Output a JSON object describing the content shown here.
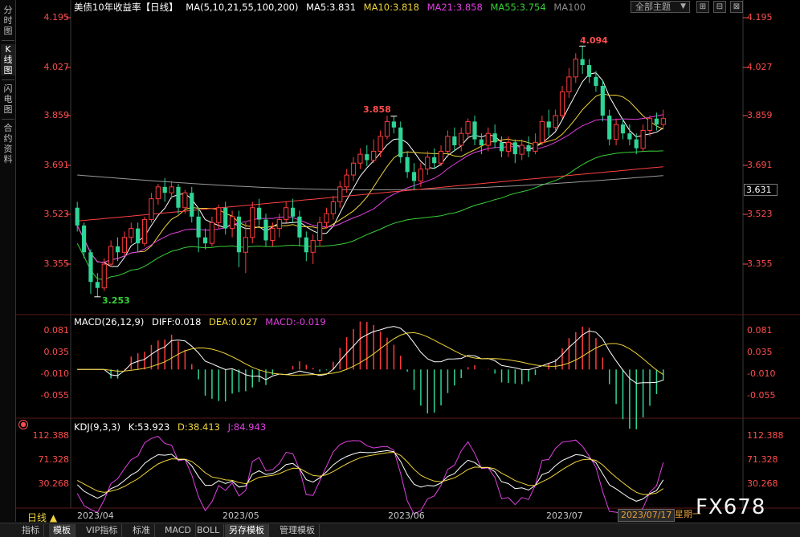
{
  "left_toolbar": {
    "items": [
      {
        "label": "分\n时\n图"
      },
      {
        "label": "K\n线\n图"
      },
      {
        "label": "闪\n电\n图"
      },
      {
        "label": "合\n约\n资\n料"
      }
    ]
  },
  "header": {
    "title": "美债10年收益率",
    "period_tag": "【日线】",
    "ma_params": "MA(5,10,21,55,100,200)",
    "ma5": "MA5:3.831",
    "ma10": "MA10:3.818",
    "ma21": "MA21:3.858",
    "ma55": "MA55:3.754",
    "ma100": "MA100",
    "theme_label": "全部主题",
    "window_buttons": [
      "⊞",
      "⊟",
      "⊠"
    ]
  },
  "main_axis": {
    "left_ticks": [
      "4.195",
      "4.027",
      "3.859",
      "3.691",
      "3.523",
      "3.355"
    ],
    "right_ticks": [
      "4.195",
      "4.027",
      "3.859",
      "3.691",
      "3.523",
      "3.355"
    ],
    "last_price": "3.631",
    "high_label": "4.094",
    "mid_high_label": "3.858",
    "low_label": "3.253"
  },
  "macd": {
    "title": "MACD(26,12,9)",
    "diff": "DIFF:0.018",
    "dea": "DEA:0.027",
    "macd": "MACD:-0.019",
    "ticks": [
      "0.081",
      "0.035",
      "-0.010",
      "-0.055"
    ]
  },
  "kdj": {
    "title": "KDJ(9,3,3)",
    "k": "K:53.923",
    "d": "D:38.413",
    "j": "J:84.943",
    "ticks": [
      "112.388",
      "71.328",
      "30.268"
    ]
  },
  "date_axis": {
    "period": "日线 ▲",
    "labels": [
      "2023/04",
      "2023/05",
      "2023/06",
      "2023/07"
    ],
    "cursor_date": "2023/07/17",
    "cursor_week": "星期一"
  },
  "watermark": "FX678",
  "bottom_tabs": [
    "指标",
    "模板",
    "VIP指标",
    "标准",
    "MACD",
    "BOLL",
    "另存模板",
    "管理模板"
  ],
  "colors": {
    "up": "#ff3b3b",
    "down": "#2fd596",
    "ma5": "#ffffff",
    "ma10": "#f0d43a",
    "ma21": "#e040e0",
    "ma55": "#38d038",
    "ma100": "#9a9a9a",
    "ma200": "#ff4040"
  },
  "chart_data": {
    "type": "candlestick",
    "series_open_close_high_low": [
      [
        3.55,
        3.49,
        3.57,
        3.47
      ],
      [
        3.49,
        3.4,
        3.5,
        3.38
      ],
      [
        3.4,
        3.3,
        3.41,
        3.26
      ],
      [
        3.3,
        3.28,
        3.33,
        3.25
      ],
      [
        3.28,
        3.36,
        3.38,
        3.27
      ],
      [
        3.36,
        3.42,
        3.44,
        3.35
      ],
      [
        3.42,
        3.4,
        3.45,
        3.37
      ],
      [
        3.4,
        3.45,
        3.47,
        3.39
      ],
      [
        3.45,
        3.48,
        3.5,
        3.43
      ],
      [
        3.48,
        3.43,
        3.5,
        3.4
      ],
      [
        3.43,
        3.51,
        3.52,
        3.42
      ],
      [
        3.51,
        3.58,
        3.6,
        3.5
      ],
      [
        3.58,
        3.62,
        3.63,
        3.56
      ],
      [
        3.62,
        3.6,
        3.65,
        3.57
      ],
      [
        3.6,
        3.62,
        3.64,
        3.58
      ],
      [
        3.62,
        3.55,
        3.63,
        3.53
      ],
      [
        3.55,
        3.6,
        3.61,
        3.53
      ],
      [
        3.6,
        3.52,
        3.62,
        3.5
      ],
      [
        3.52,
        3.45,
        3.55,
        3.4
      ],
      [
        3.45,
        3.43,
        3.48,
        3.41
      ],
      [
        3.43,
        3.5,
        3.52,
        3.42
      ],
      [
        3.5,
        3.55,
        3.56,
        3.48
      ],
      [
        3.55,
        3.48,
        3.57,
        3.46
      ],
      [
        3.48,
        3.52,
        3.54,
        3.45
      ],
      [
        3.52,
        3.4,
        3.54,
        3.35
      ],
      [
        3.4,
        3.45,
        3.5,
        3.33
      ],
      [
        3.45,
        3.55,
        3.57,
        3.43
      ],
      [
        3.55,
        3.51,
        3.58,
        3.49
      ],
      [
        3.51,
        3.44,
        3.53,
        3.42
      ],
      [
        3.44,
        3.48,
        3.5,
        3.42
      ],
      [
        3.48,
        3.51,
        3.53,
        3.45
      ],
      [
        3.51,
        3.55,
        3.57,
        3.5
      ],
      [
        3.55,
        3.52,
        3.58,
        3.5
      ],
      [
        3.52,
        3.45,
        3.54,
        3.42
      ],
      [
        3.45,
        3.4,
        3.47,
        3.37
      ],
      [
        3.4,
        3.44,
        3.46,
        3.36
      ],
      [
        3.44,
        3.5,
        3.52,
        3.42
      ],
      [
        3.5,
        3.53,
        3.55,
        3.48
      ],
      [
        3.53,
        3.57,
        3.59,
        3.51
      ],
      [
        3.57,
        3.62,
        3.64,
        3.55
      ],
      [
        3.62,
        3.66,
        3.68,
        3.6
      ],
      [
        3.66,
        3.7,
        3.72,
        3.64
      ],
      [
        3.7,
        3.73,
        3.75,
        3.68
      ],
      [
        3.73,
        3.71,
        3.76,
        3.69
      ],
      [
        3.71,
        3.74,
        3.78,
        3.7
      ],
      [
        3.74,
        3.79,
        3.81,
        3.72
      ],
      [
        3.79,
        3.84,
        3.86,
        3.78
      ],
      [
        3.84,
        3.82,
        3.858,
        3.8
      ],
      [
        3.82,
        3.72,
        3.84,
        3.7
      ],
      [
        3.72,
        3.67,
        3.74,
        3.65
      ],
      [
        3.67,
        3.64,
        3.7,
        3.61
      ],
      [
        3.64,
        3.68,
        3.7,
        3.62
      ],
      [
        3.68,
        3.72,
        3.74,
        3.66
      ],
      [
        3.72,
        3.7,
        3.75,
        3.68
      ],
      [
        3.7,
        3.74,
        3.76,
        3.69
      ],
      [
        3.74,
        3.79,
        3.81,
        3.72
      ],
      [
        3.79,
        3.76,
        3.82,
        3.74
      ],
      [
        3.76,
        3.8,
        3.82,
        3.74
      ],
      [
        3.8,
        3.84,
        3.85,
        3.78
      ],
      [
        3.84,
        3.78,
        3.86,
        3.76
      ],
      [
        3.78,
        3.76,
        3.8,
        3.73
      ],
      [
        3.76,
        3.8,
        3.82,
        3.74
      ],
      [
        3.8,
        3.77,
        3.83,
        3.75
      ],
      [
        3.77,
        3.74,
        3.79,
        3.72
      ],
      [
        3.74,
        3.77,
        3.79,
        3.72
      ],
      [
        3.77,
        3.73,
        3.78,
        3.7
      ],
      [
        3.73,
        3.76,
        3.78,
        3.71
      ],
      [
        3.76,
        3.74,
        3.79,
        3.72
      ],
      [
        3.74,
        3.77,
        3.8,
        3.73
      ],
      [
        3.77,
        3.84,
        3.86,
        3.76
      ],
      [
        3.84,
        3.82,
        3.88,
        3.79
      ],
      [
        3.82,
        3.86,
        3.88,
        3.81
      ],
      [
        3.86,
        3.94,
        3.96,
        3.85
      ],
      [
        3.94,
        3.99,
        4.02,
        3.92
      ],
      [
        3.99,
        4.05,
        4.07,
        3.97
      ],
      [
        4.05,
        4.03,
        4.094,
        4.0
      ],
      [
        4.03,
        3.99,
        4.05,
        3.97
      ],
      [
        3.99,
        3.96,
        4.01,
        3.94
      ],
      [
        3.96,
        3.86,
        3.98,
        3.84
      ],
      [
        3.86,
        3.78,
        3.88,
        3.76
      ],
      [
        3.78,
        3.83,
        3.85,
        3.76
      ],
      [
        3.83,
        3.8,
        3.85,
        3.78
      ],
      [
        3.8,
        3.78,
        3.83,
        3.76
      ],
      [
        3.78,
        3.75,
        3.8,
        3.73
      ],
      [
        3.75,
        3.81,
        3.83,
        3.74
      ],
      [
        3.81,
        3.85,
        3.86,
        3.79
      ],
      [
        3.85,
        3.83,
        3.87,
        3.81
      ],
      [
        3.83,
        3.85,
        3.88,
        3.82
      ]
    ],
    "ylim": [
      3.25,
      4.195
    ]
  }
}
